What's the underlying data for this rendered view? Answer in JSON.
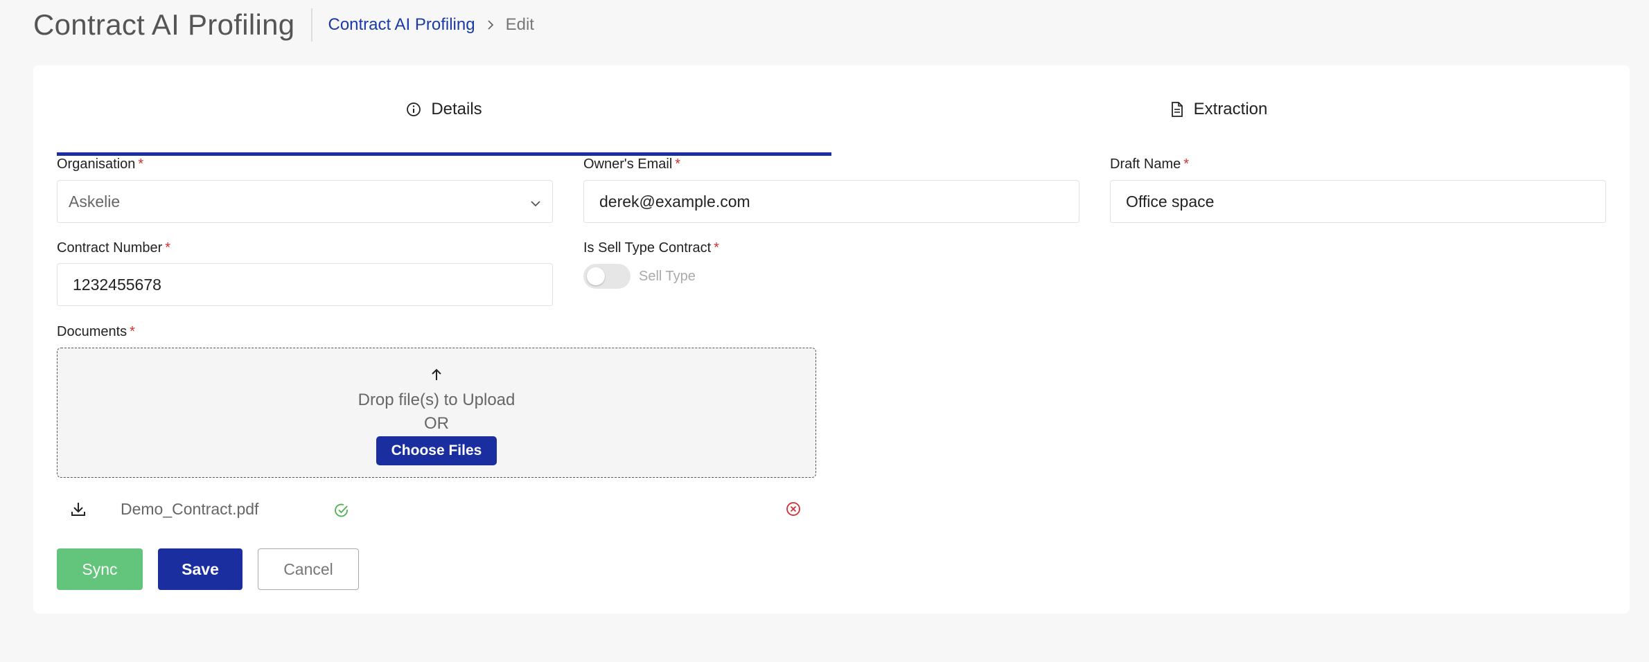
{
  "header": {
    "title": "Contract AI Profiling",
    "breadcrumb": {
      "link": "Contract AI Profiling",
      "current": "Edit"
    }
  },
  "tabs": [
    {
      "label": "Details",
      "icon": "info-icon",
      "active": true
    },
    {
      "label": "Extraction",
      "icon": "document-icon",
      "active": false
    }
  ],
  "form": {
    "organisation": {
      "label": "Organisation",
      "value": "Askelie"
    },
    "owners_email": {
      "label": "Owner's Email",
      "value": "derek@example.com"
    },
    "draft_name": {
      "label": "Draft Name",
      "value": "Office space"
    },
    "contract_number": {
      "label": "Contract Number",
      "value": "1232455678"
    },
    "is_sell_type": {
      "label": "Is Sell Type Contract",
      "toggle_label": "Sell Type",
      "checked": false
    },
    "documents": {
      "label": "Documents",
      "drop_text": "Drop file(s) to Upload",
      "or_text": "OR",
      "choose_label": "Choose Files",
      "files": [
        {
          "name": "Demo_Contract.pdf",
          "status": "uploaded"
        }
      ]
    },
    "required_mark": "*"
  },
  "actions": {
    "sync": "Sync",
    "save": "Save",
    "cancel": "Cancel"
  },
  "colors": {
    "primary": "#1a2ea0",
    "success": "#63c57b",
    "danger": "#d32f2f"
  }
}
